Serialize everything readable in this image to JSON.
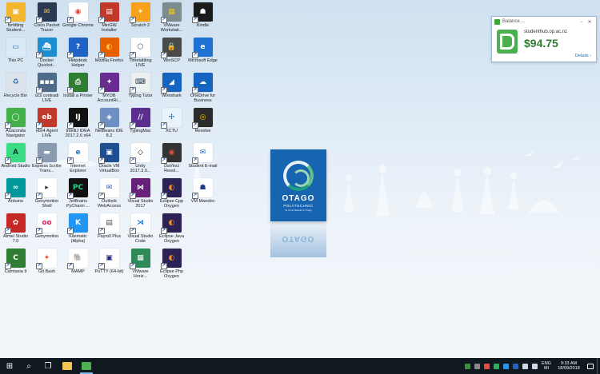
{
  "desktop": {
    "icons": [
      {
        "name": "fileshare-icon",
        "label": "fortitting Student...",
        "bg": "#f3b62f",
        "glyph": "▣",
        "fg": "#ffffff",
        "shortcut": true
      },
      {
        "name": "cisco-packet-tracer-icon",
        "label": "Cisco Packet Tracer",
        "bg": "#2a3a52",
        "glyph": "✉",
        "fg": "#f2c14e",
        "shortcut": true
      },
      {
        "name": "chrome-icon",
        "label": "Google Chrome",
        "bg": "#ffffff",
        "glyph": "◉",
        "fg": "#db4437",
        "shortcut": true
      },
      {
        "name": "minow-installer-icon",
        "label": "MinGW Installer",
        "bg": "#c0392b",
        "glyph": "▤",
        "fg": "#ffffff",
        "shortcut": true
      },
      {
        "name": "scratch-icon",
        "label": "Scratch 2",
        "bg": "#f7a01b",
        "glyph": "✶",
        "fg": "#ffffff",
        "shortcut": true
      },
      {
        "name": "vmware-workstation-icon",
        "label": "VMware Workstati...",
        "bg": "#7f8c8d",
        "glyph": "▦",
        "fg": "#f1c40f",
        "shortcut": true
      },
      {
        "name": "kindle-icon",
        "label": "Kindle",
        "bg": "#1b1b1b",
        "glyph": "☗",
        "fg": "#ffffff",
        "shortcut": true
      },
      {
        "name": "this-pc-icon",
        "label": "This PC",
        "bg": "#dce9f6",
        "glyph": "▭",
        "fg": "#2b6cb0",
        "shortcut": false
      },
      {
        "name": "docker-icon",
        "label": "Docker Quickst...",
        "bg": "#1d8fd1",
        "glyph": "⛴",
        "fg": "#ffffff",
        "shortcut": true
      },
      {
        "name": "help-icon",
        "label": "Helpdesk Helper",
        "bg": "#1e63c6",
        "glyph": "?",
        "fg": "#ffffff",
        "shortcut": true
      },
      {
        "name": "firefox-icon",
        "label": "Mozilla Firefox",
        "bg": "#e66000",
        "glyph": "◐",
        "fg": "#ffcb47",
        "shortcut": true
      },
      {
        "name": "timetabling-icon",
        "label": "Timetabling LIVE",
        "bg": "#ffffff",
        "glyph": "⬡",
        "fg": "#555555",
        "shortcut": true
      },
      {
        "name": "winscp-icon",
        "label": "WinSCP",
        "bg": "#4a4a4a",
        "glyph": "🔒",
        "fg": "#ffffff",
        "shortcut": true
      },
      {
        "name": "edge-icon",
        "label": "Microsoft Edge",
        "bg": "#1e73d2",
        "glyph": "e",
        "fg": "#ffffff",
        "shortcut": true
      },
      {
        "name": "recycle-bin-icon",
        "label": "Recycle Bin",
        "bg": "#dce3ea",
        "glyph": "♻",
        "fg": "#2b6cb0",
        "shortcut": false
      },
      {
        "name": "ucs-remote-icon",
        "label": "ucs contradi LIVE",
        "bg": "#4f6b8a",
        "glyph": "▪▪▪",
        "fg": "#ffffff",
        "shortcut": true
      },
      {
        "name": "install-printer-icon",
        "label": "Install a Printer",
        "bg": "#2f7d32",
        "glyph": "⎙",
        "fg": "#ffffff",
        "shortcut": true
      },
      {
        "name": "myob-icon",
        "label": "MYOB AccountRi...",
        "bg": "#6a2c91",
        "glyph": "✦",
        "fg": "#ffffff",
        "shortcut": true
      },
      {
        "name": "typing-tutor-icon",
        "label": "Typing Tutor",
        "bg": "#ecf0f1",
        "glyph": "⌨",
        "fg": "#2c3e50",
        "shortcut": true
      },
      {
        "name": "wireshark-icon",
        "label": "Wireshark",
        "bg": "#1565c0",
        "glyph": "◢",
        "fg": "#ffffff",
        "shortcut": true
      },
      {
        "name": "onedrive-business-icon",
        "label": "OneDrive for Business",
        "bg": "#1565c0",
        "glyph": "☁",
        "fg": "#ffffff",
        "shortcut": true
      },
      {
        "name": "anaconda-icon",
        "label": "Anaconda Navigator",
        "bg": "#43b049",
        "glyph": "◯",
        "fg": "#ffffff",
        "shortcut": true
      },
      {
        "name": "ebs-agent-icon",
        "label": "ebs4 Agent LIVE",
        "bg": "#c0392b",
        "glyph": "eb",
        "fg": "#ffffff",
        "shortcut": true
      },
      {
        "name": "intellij-icon",
        "label": "IntelliJ IDEA 2017.2.6 x64",
        "bg": "#111111",
        "glyph": "IJ",
        "fg": "#ffffff",
        "shortcut": true
      },
      {
        "name": "netbeans-icon",
        "label": "NetBeans IDE 8.2",
        "bg": "#6d8fc2",
        "glyph": "◈",
        "fg": "#ffffff",
        "shortcut": true
      },
      {
        "name": "typingmac-icon",
        "label": "TypingMac",
        "bg": "#5b2d8e",
        "glyph": "//",
        "fg": "#ffffff",
        "shortcut": true
      },
      {
        "name": "xctu-icon",
        "label": "XCTU",
        "bg": "#eaf2fb",
        "glyph": "✢",
        "fg": "#2b6cb0",
        "shortcut": true
      },
      {
        "name": "resolve-icon",
        "label": "Resolve",
        "bg": "#2b2b2b",
        "glyph": "◎",
        "fg": "#f1c40f",
        "shortcut": true
      },
      {
        "name": "android-studio-icon",
        "label": "Android Studio",
        "bg": "#3ddc84",
        "glyph": "A",
        "fg": "#0b3d2e",
        "shortcut": true
      },
      {
        "name": "expression-icon",
        "label": "Express Scribe Trans...",
        "bg": "#8a9bb0",
        "glyph": "▬",
        "fg": "#ffffff",
        "shortcut": true
      },
      {
        "name": "ie-icon",
        "label": "Internet Explorer",
        "bg": "#ffffff",
        "glyph": "e",
        "fg": "#1e73d2",
        "shortcut": true
      },
      {
        "name": "virtualbox-icon",
        "label": "Oracle VM VirtualBox",
        "bg": "#1d4f91",
        "glyph": "▣",
        "fg": "#ffffff",
        "shortcut": true
      },
      {
        "name": "unity-icon",
        "label": "Unity 2017.3.0...",
        "bg": "#ffffff",
        "glyph": "◇",
        "fg": "#222222",
        "shortcut": true
      },
      {
        "name": "davinci-resolve-icon",
        "label": "DaVinci Resol...",
        "bg": "#333333",
        "glyph": "◉",
        "fg": "#e74c3c",
        "shortcut": true
      },
      {
        "name": "student-email-icon",
        "label": "Student E-mail",
        "bg": "#ffffff",
        "glyph": "✉",
        "fg": "#1e63c6",
        "shortcut": true
      },
      {
        "name": "arduino-icon",
        "label": "Arduino",
        "bg": "#00979c",
        "glyph": "∞",
        "fg": "#ffffff",
        "shortcut": true
      },
      {
        "name": "genymotion-shell-icon",
        "label": "Genymotion Shell",
        "bg": "#ffffff",
        "glyph": "▸",
        "fg": "#333333",
        "shortcut": true
      },
      {
        "name": "pycharm-icon",
        "label": "JetBrains PyCharm ...",
        "bg": "#111111",
        "glyph": "PC",
        "fg": "#21d789",
        "shortcut": true
      },
      {
        "name": "outlook-web-icon",
        "label": "Outlook WebAccess",
        "bg": "#ffffff",
        "glyph": "✉",
        "fg": "#1e63c6",
        "shortcut": true
      },
      {
        "name": "visual-studio-icon",
        "label": "Visual Studio 2017",
        "bg": "#68217a",
        "glyph": "⋈",
        "fg": "#ffffff",
        "shortcut": true
      },
      {
        "name": "eclipse-cpp-icon",
        "label": "Eclipse Cpp Oxygen",
        "bg": "#2c2255",
        "glyph": "◐",
        "fg": "#f7941e",
        "shortcut": true
      },
      {
        "name": "vm-maestro-icon",
        "label": "VM Maestro",
        "bg": "#ffffff",
        "glyph": "☗",
        "fg": "#1e3f8a",
        "shortcut": true
      },
      {
        "name": "atmel-studio-icon",
        "label": "Atmel Studio 7.0",
        "bg": "#c62828",
        "glyph": "✿",
        "fg": "#ffffff",
        "shortcut": true
      },
      {
        "name": "genymotion-icon",
        "label": "Genymotion",
        "bg": "#ffffff",
        "glyph": "oo",
        "fg": "#e91e63",
        "shortcut": true
      },
      {
        "name": "kinematic-icon",
        "label": "Kitematic (Alpha)",
        "bg": "#2196f3",
        "glyph": "K",
        "fg": "#ffffff",
        "shortcut": true
      },
      {
        "name": "payroll-plus-icon",
        "label": "Payroll Plus",
        "bg": "#ffffff",
        "glyph": "▤",
        "fg": "#555555",
        "shortcut": true
      },
      {
        "name": "vscode-icon",
        "label": "Visual Studio Code",
        "bg": "#ffffff",
        "glyph": "⋊",
        "fg": "#1e73d2",
        "shortcut": true
      },
      {
        "name": "eclipse-java-icon",
        "label": "Eclipse Java Oxygen",
        "bg": "#2c2255",
        "glyph": "◐",
        "fg": "#f7941e",
        "shortcut": true
      },
      {
        "name": "empty-slot-1",
        "label": "",
        "bg": "transparent",
        "glyph": "",
        "fg": "#000000",
        "shortcut": false
      },
      {
        "name": "camtasia-icon",
        "label": "Camtasia 9",
        "bg": "#2e7d32",
        "glyph": "C",
        "fg": "#ffffff",
        "shortcut": true
      },
      {
        "name": "git-bash-icon",
        "label": "Git Bash",
        "bg": "#ffffff",
        "glyph": "✦",
        "fg": "#f14e32",
        "shortcut": true
      },
      {
        "name": "mamp-icon",
        "label": "MAMP",
        "bg": "#ffffff",
        "glyph": "🐘",
        "fg": "#333333",
        "shortcut": true
      },
      {
        "name": "putty-icon",
        "label": "PuTTY (64-bit)",
        "bg": "#ffffff",
        "glyph": "▣",
        "fg": "#1a237e",
        "shortcut": true
      },
      {
        "name": "vmware-horizon-icon",
        "label": "VMware Horiz...",
        "bg": "#2e8b57",
        "glyph": "▦",
        "fg": "#ffffff",
        "shortcut": true
      },
      {
        "name": "eclipse-php-icon",
        "label": "Eclipse Php Oxygen",
        "bg": "#2c2255",
        "glyph": "◐",
        "fg": "#f7941e",
        "shortcut": true
      },
      {
        "name": "empty-slot-2",
        "label": "",
        "bg": "transparent",
        "glyph": "",
        "fg": "#000000",
        "shortcut": false
      }
    ]
  },
  "logo": {
    "name": "OTAGO",
    "subtitle": "POLYTECHNIC",
    "tagline": "Te Kura Matatini ki Otago"
  },
  "balance_widget": {
    "title": "Balance ...",
    "host": "studenthub.op.ac.nz",
    "amount": "$94.75",
    "details_link": "Details ›",
    "minimize": "–",
    "close": "✕"
  },
  "taskbar": {
    "start_glyph": "⊞",
    "search_glyph": "⌕",
    "taskview_glyph": "❐",
    "apps": [
      {
        "name": "file-explorer-icon",
        "color": "#f3c74f",
        "active": false
      },
      {
        "name": "papercut-taskbar-icon",
        "color": "#4caf50",
        "active": true
      }
    ],
    "tray": [
      {
        "name": "tray-app-1-icon",
        "color": "#3a8f3a"
      },
      {
        "name": "tray-app-2-icon",
        "color": "#888888"
      },
      {
        "name": "tray-app-3-icon",
        "color": "#e74c3c"
      },
      {
        "name": "tray-app-4-icon",
        "color": "#27ae60"
      },
      {
        "name": "tray-app-5-icon",
        "color": "#2196f3"
      },
      {
        "name": "tray-app-6-icon",
        "color": "#1e63c6"
      },
      {
        "name": "tray-network-icon",
        "color": "#cfd8e3"
      },
      {
        "name": "tray-volume-icon",
        "color": "#cfd8e3"
      }
    ],
    "language_top": "ENG",
    "language_bottom": "MI",
    "time": "9:33 AM",
    "date": "18/09/2018"
  }
}
